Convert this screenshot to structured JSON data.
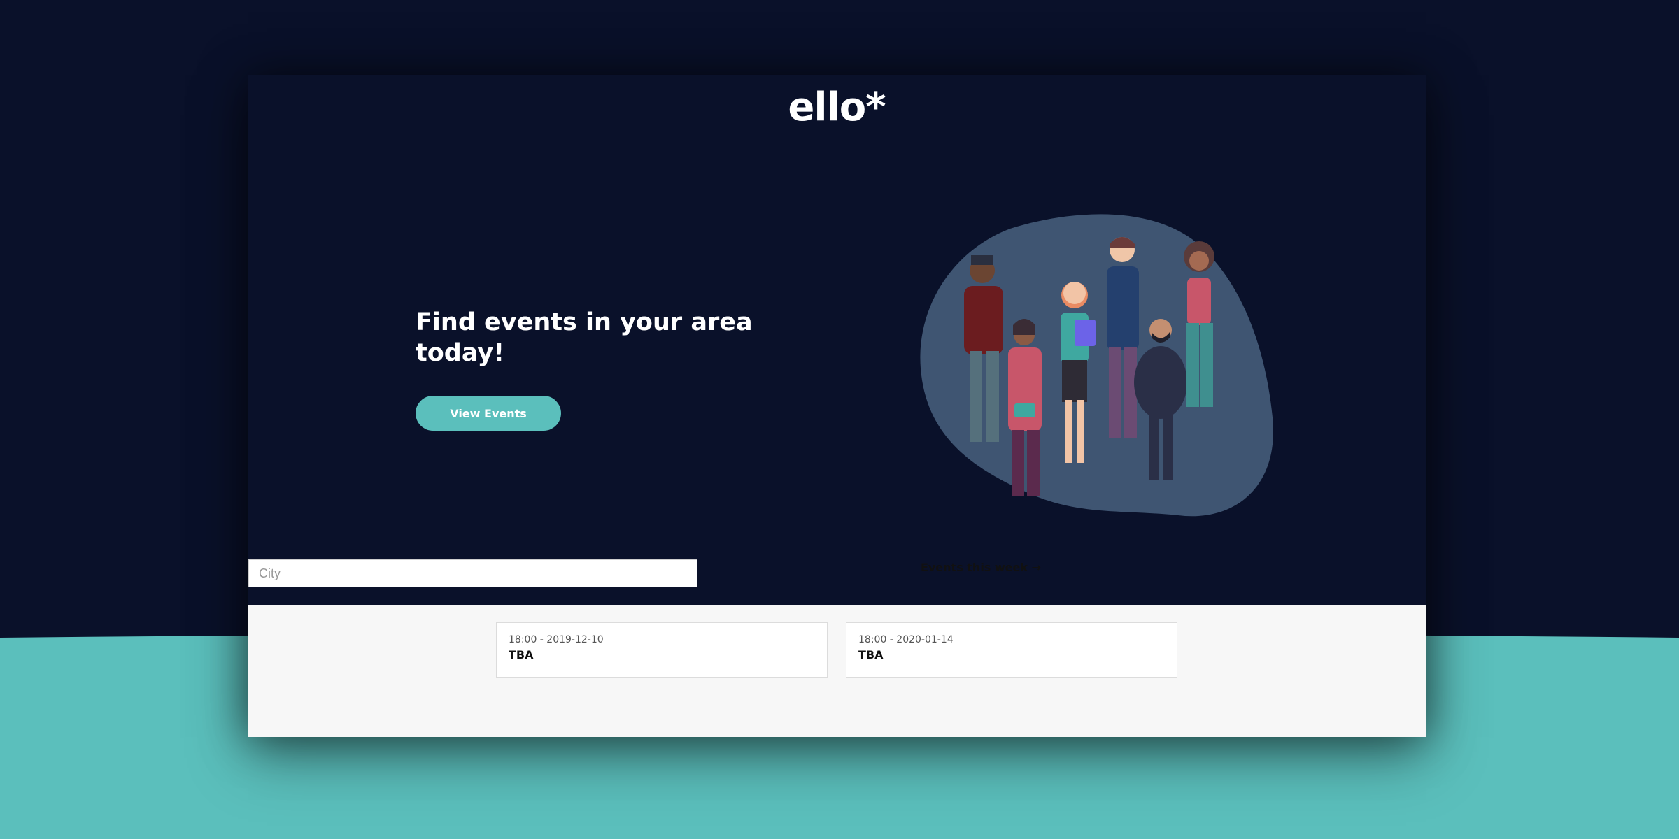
{
  "brand": {
    "logo_text": "ello*"
  },
  "hero": {
    "headline": "Find events in your area today!",
    "cta_label": "View Events"
  },
  "search": {
    "city_placeholder": "City",
    "city_value": ""
  },
  "events_week_link": "Events this week →",
  "events": [
    {
      "meta": "18:00 - 2019-12-10",
      "title": "TBA"
    },
    {
      "meta": "18:00 - 2020-01-14",
      "title": "TBA"
    }
  ],
  "colors": {
    "background_dark": "#0a112a",
    "accent_teal": "#5bbfbc",
    "blob": "#3f5572",
    "lower_section": "#f7f7f7"
  }
}
